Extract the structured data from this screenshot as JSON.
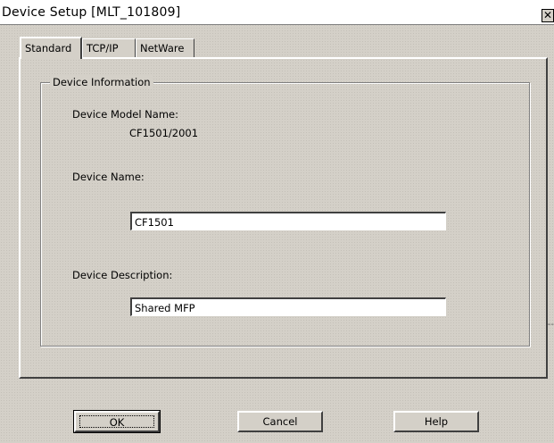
{
  "window": {
    "title": "Device Setup [MLT_101809]",
    "close_glyph": "✕"
  },
  "tabs": [
    {
      "label": "Standard",
      "active": true
    },
    {
      "label": "TCP/IP",
      "active": false
    },
    {
      "label": "NetWare",
      "active": false
    }
  ],
  "device_info": {
    "group_title": "Device Information",
    "model_label": "Device Model Name:",
    "model_value": "CF1501/2001",
    "name_label": "Device Name:",
    "name_value": "CF1501",
    "description_label": "Device Description:",
    "description_value": "Shared MFP"
  },
  "buttons": {
    "ok": "OK",
    "cancel": "Cancel",
    "help": "Help"
  },
  "edge_mark": "--"
}
